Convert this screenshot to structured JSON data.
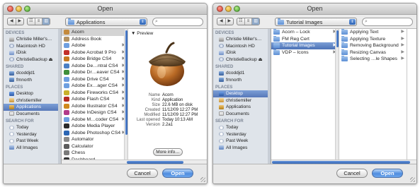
{
  "windows": [
    {
      "title": "Open",
      "nav": {
        "back": "◀",
        "forward": "▶"
      },
      "view_modes": [
        "☷",
        "≡",
        "▥"
      ],
      "location": "Applications",
      "search_placeholder": "",
      "sidebar": {
        "sections": [
          {
            "header": "DEVICES",
            "items": [
              {
                "label": "Christie Miller's…",
                "icon": "hard-drive-icon",
                "selected": false
              },
              {
                "label": "Macintosh HD",
                "icon": "disk-icon",
                "selected": false
              },
              {
                "label": "iDisk",
                "icon": "idisk-icon",
                "selected": false
              },
              {
                "label": "ChristieBackup ⏏",
                "icon": "disk-icon",
                "selected": false
              }
            ]
          },
          {
            "header": "SHARED",
            "items": [
              {
                "label": "dcoddjd1",
                "icon": "network-icon",
                "selected": false
              },
              {
                "label": "fmnorth",
                "icon": "network-icon",
                "selected": false
              }
            ]
          },
          {
            "header": "PLACES",
            "items": [
              {
                "label": "Desktop",
                "icon": "desktop-icon",
                "selected": false
              },
              {
                "label": "christiemiller",
                "icon": "home-icon",
                "selected": false
              },
              {
                "label": "Applications",
                "icon": "applications-icon",
                "selected": true
              },
              {
                "label": "Documents",
                "icon": "documents-icon",
                "selected": false
              }
            ]
          },
          {
            "header": "SEARCH FOR",
            "items": [
              {
                "label": "Today",
                "icon": "clock-icon",
                "selected": false
              },
              {
                "label": "Yesterday",
                "icon": "clock-icon",
                "selected": false
              },
              {
                "label": "Past Week",
                "icon": "clock-icon",
                "selected": false
              },
              {
                "label": "All Images",
                "icon": "images-icon",
                "selected": false
              }
            ]
          }
        ]
      },
      "file_list": [
        {
          "label": "Acorn",
          "color": "#c48a3c",
          "arrow": false,
          "selected": true
        },
        {
          "label": "Address Book",
          "color": "#b39262",
          "arrow": false,
          "selected": false
        },
        {
          "label": "Adobe",
          "color": "#6e9fe0",
          "arrow": true,
          "selected": false
        },
        {
          "label": "Adobe Acrobat 9 Pro",
          "color": "#c3302a",
          "arrow": true,
          "selected": false
        },
        {
          "label": "Adobe Bridge CS4",
          "color": "#c77a21",
          "arrow": true,
          "selected": false
        },
        {
          "label": "Adobe De…ntral CS4",
          "color": "#4a7fc4",
          "arrow": true,
          "selected": false
        },
        {
          "label": "Adobe Dr…eaver CS4",
          "color": "#3f8f3a",
          "arrow": true,
          "selected": false
        },
        {
          "label": "Adobe Drive CS4",
          "color": "#6e9fe0",
          "arrow": true,
          "selected": false
        },
        {
          "label": "Adobe Ex…ager CS4",
          "color": "#6e9fe0",
          "arrow": true,
          "selected": false
        },
        {
          "label": "Adobe Fireworks CS4",
          "color": "#c9b12a",
          "arrow": true,
          "selected": false
        },
        {
          "label": "Adobe Flash CS4",
          "color": "#b52b22",
          "arrow": true,
          "selected": false
        },
        {
          "label": "Adobe Illustrator CS4",
          "color": "#d08a1c",
          "arrow": true,
          "selected": false
        },
        {
          "label": "Adobe InDesign CS4",
          "color": "#b23a8a",
          "arrow": true,
          "selected": false
        },
        {
          "label": "Adobe M…coder CS4",
          "color": "#6e9fe0",
          "arrow": true,
          "selected": false
        },
        {
          "label": "Adobe Media Player",
          "color": "#2c2c2c",
          "arrow": false,
          "selected": false
        },
        {
          "label": "Adobe Photoshop CS4",
          "color": "#2c66b4",
          "arrow": true,
          "selected": false
        },
        {
          "label": "Automator",
          "color": "#8a8a8a",
          "arrow": false,
          "selected": false
        },
        {
          "label": "Calculator",
          "color": "#5d5d5d",
          "arrow": false,
          "selected": false
        },
        {
          "label": "Chess",
          "color": "#7a7a7a",
          "arrow": false,
          "selected": false
        },
        {
          "label": "Dashboard",
          "color": "#333333",
          "arrow": false,
          "selected": false
        }
      ],
      "preview": {
        "header": "▼ Preview",
        "image_icon": "acorn-app-icon",
        "meta": [
          {
            "key": "Name",
            "value": "Acorn"
          },
          {
            "key": "Kind",
            "value": "Application"
          },
          {
            "key": "Size",
            "value": "22.6 MB on disk"
          },
          {
            "key": "Created",
            "value": "11/12/09 12:27 PM"
          },
          {
            "key": "Modified",
            "value": "11/12/09 12:27 PM"
          },
          {
            "key": "Last opened",
            "value": "Today 10:13 AM"
          },
          {
            "key": "Version",
            "value": "2.2a1"
          }
        ],
        "more_info": "More info…"
      },
      "buttons": {
        "cancel": "Cancel",
        "open": "Open"
      }
    },
    {
      "title": "Open",
      "nav": {
        "back": "◀",
        "forward": "▶"
      },
      "view_modes": [
        "☷",
        "≡",
        "▥"
      ],
      "location": "Tutorial Images",
      "search_placeholder": "",
      "sidebar": {
        "sections": [
          {
            "header": "DEVICES",
            "items": [
              {
                "label": "Christie Miller's…",
                "icon": "hard-drive-icon",
                "selected": false
              },
              {
                "label": "Macintosh HD",
                "icon": "disk-icon",
                "selected": false
              },
              {
                "label": "iDisk",
                "icon": "idisk-icon",
                "selected": false
              },
              {
                "label": "ChristieBackup ⏏",
                "icon": "disk-icon",
                "selected": false
              }
            ]
          },
          {
            "header": "SHARED",
            "items": [
              {
                "label": "dcoddjd1",
                "icon": "network-icon",
                "selected": false
              },
              {
                "label": "fmnorth",
                "icon": "network-icon",
                "selected": false
              }
            ]
          },
          {
            "header": "PLACES",
            "items": [
              {
                "label": "Desktop",
                "icon": "desktop-icon",
                "selected": true
              },
              {
                "label": "christiemiller",
                "icon": "home-icon",
                "selected": false
              },
              {
                "label": "Applications",
                "icon": "applications-icon",
                "selected": false
              },
              {
                "label": "Documents",
                "icon": "documents-icon",
                "selected": false
              }
            ]
          },
          {
            "header": "SEARCH FOR",
            "items": [
              {
                "label": "Today",
                "icon": "clock-icon",
                "selected": false
              },
              {
                "label": "Yesterday",
                "icon": "clock-icon",
                "selected": false
              },
              {
                "label": "Past Week",
                "icon": "clock-icon",
                "selected": false
              },
              {
                "label": "All Images",
                "icon": "images-icon",
                "selected": false
              }
            ]
          }
        ]
      },
      "column1": [
        {
          "label": "Acorn – Lock",
          "arrow": true,
          "selected": false
        },
        {
          "label": "FM Reg Cert",
          "arrow": false,
          "selected": false
        },
        {
          "label": "Tutorial Images",
          "arrow": true,
          "selected": true
        },
        {
          "label": "VDP – Icons",
          "arrow": true,
          "selected": false
        }
      ],
      "column2": [
        {
          "label": "Applying Text",
          "arrow": true,
          "selected": false
        },
        {
          "label": "Applying Texture",
          "arrow": true,
          "selected": false
        },
        {
          "label": "Removing Background",
          "arrow": true,
          "selected": false
        },
        {
          "label": "Resizing Canvas",
          "arrow": true,
          "selected": false
        },
        {
          "label": "Selecting …le Shapes",
          "arrow": true,
          "selected": false
        }
      ],
      "buttons": {
        "cancel": "Cancel",
        "open": "Open"
      }
    }
  ]
}
